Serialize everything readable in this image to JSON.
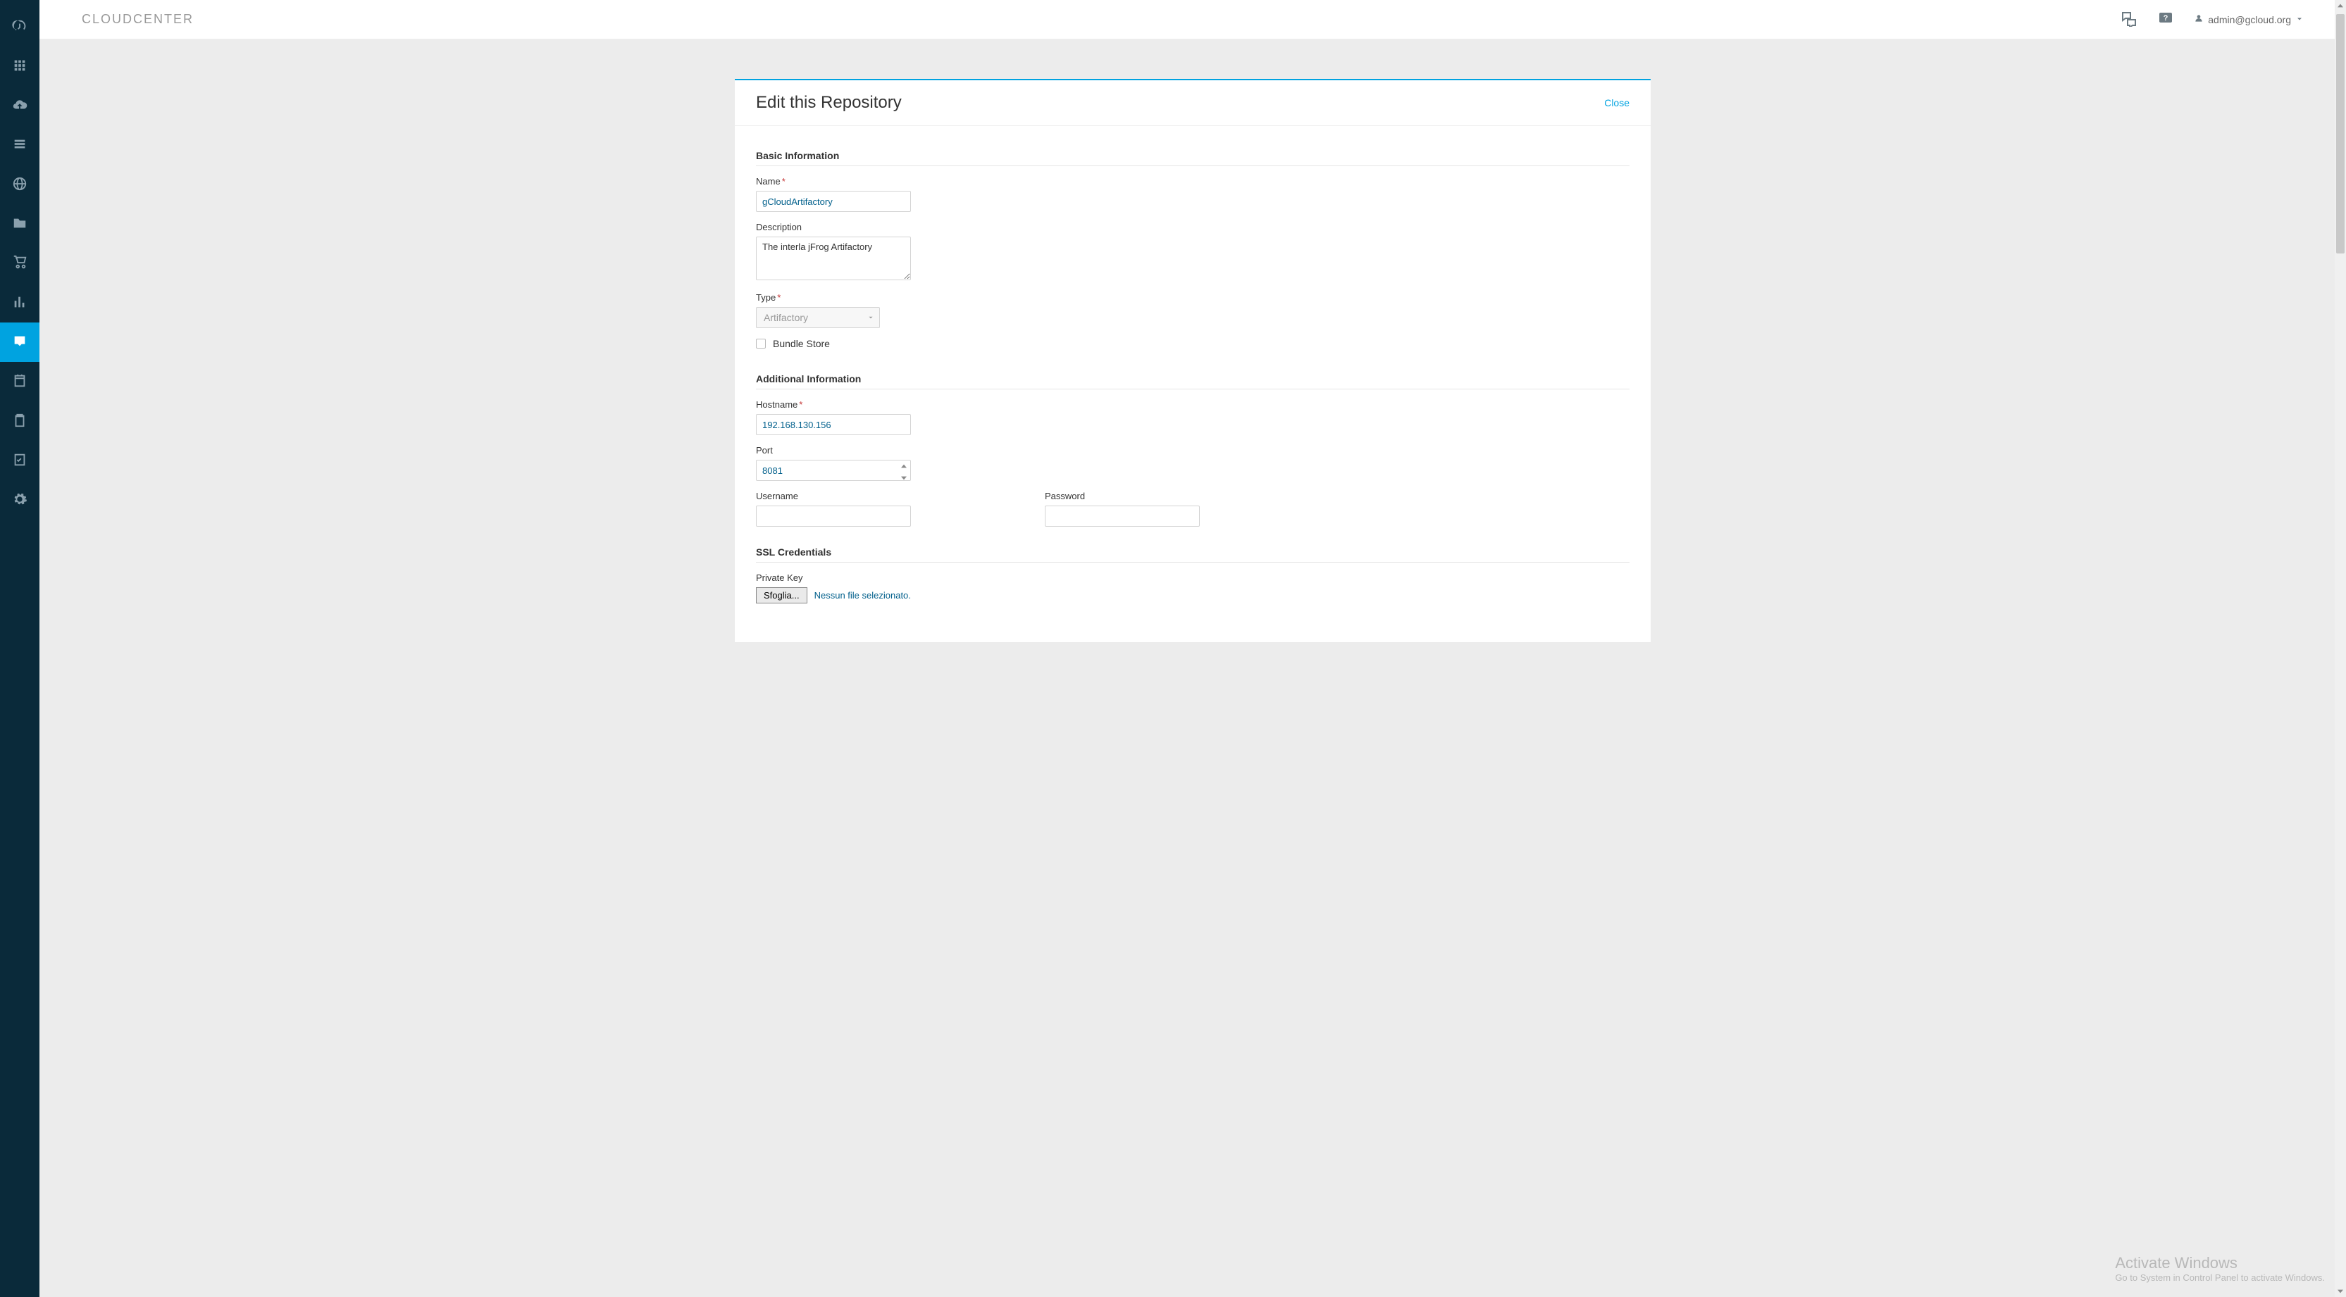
{
  "brand": "CLOUDCENTER",
  "header": {
    "user_label": "admin@gcloud.org"
  },
  "panel": {
    "title": "Edit this Repository",
    "close": "Close"
  },
  "sections": {
    "basic": "Basic Information",
    "additional": "Additional Information",
    "ssl": "SSL Credentials"
  },
  "labels": {
    "name": "Name",
    "description": "Description",
    "type": "Type",
    "bundle_store": "Bundle Store",
    "hostname": "Hostname",
    "port": "Port",
    "username": "Username",
    "password": "Password",
    "private_key": "Private Key"
  },
  "values": {
    "name": "gCloudArtifactory",
    "description": "The interla jFrog Artifactory",
    "type": "Artifactory",
    "hostname": "192.168.130.156",
    "port": "8081",
    "username": "",
    "password": ""
  },
  "file": {
    "browse": "Sfoglia...",
    "none_selected": "Nessun file selezionato."
  },
  "watermark": {
    "title": "Activate Windows",
    "sub": "Go to System in Control Panel to activate Windows."
  },
  "sidebar_icons": [
    "gauge-icon",
    "apps-icon",
    "cloud-upload-icon",
    "stack-icon",
    "globe-icon",
    "folder-icon",
    "cart-icon",
    "bar-chart-icon",
    "inbox-icon",
    "calendar-icon",
    "clipboard-icon",
    "checklist-icon",
    "gear-icon"
  ],
  "active_sidebar_index": 8
}
